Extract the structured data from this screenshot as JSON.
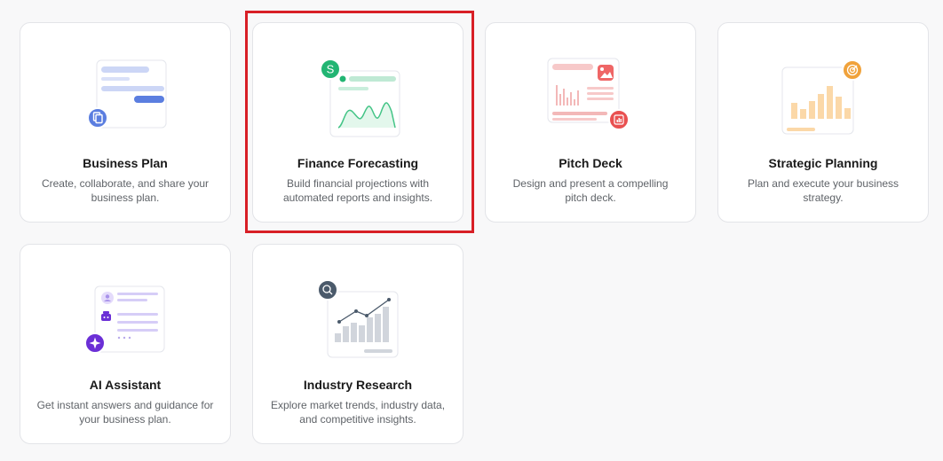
{
  "cards": [
    {
      "title": "Business Plan",
      "description": "Create, collaborate, and share your business plan."
    },
    {
      "title": "Finance Forecasting",
      "description": "Build financial projections with automated reports and insights."
    },
    {
      "title": "Pitch Deck",
      "description": "Design and present a compelling pitch deck."
    },
    {
      "title": "Strategic Planning",
      "description": "Plan and execute your business strategy."
    },
    {
      "title": "AI Assistant",
      "description": "Get instant answers and guidance for your business plan."
    },
    {
      "title": "Industry Research",
      "description": "Explore market trends, industry data, and competitive insights."
    }
  ],
  "highlighted_card": "Finance Forecasting",
  "colors": {
    "highlight": "#d81f26",
    "business_plan_accent": "#5b7ee0",
    "finance_accent": "#22b573",
    "pitch_deck_accent": "#e95050",
    "strategy_accent": "#f0a23b",
    "ai_accent": "#6b2fd6",
    "research_accent": "#4b5a6b"
  },
  "icons": [
    "document-icon",
    "dollar-icon",
    "bar-chart-icon",
    "target-icon",
    "sparkle-icon",
    "magnifier-icon"
  ]
}
